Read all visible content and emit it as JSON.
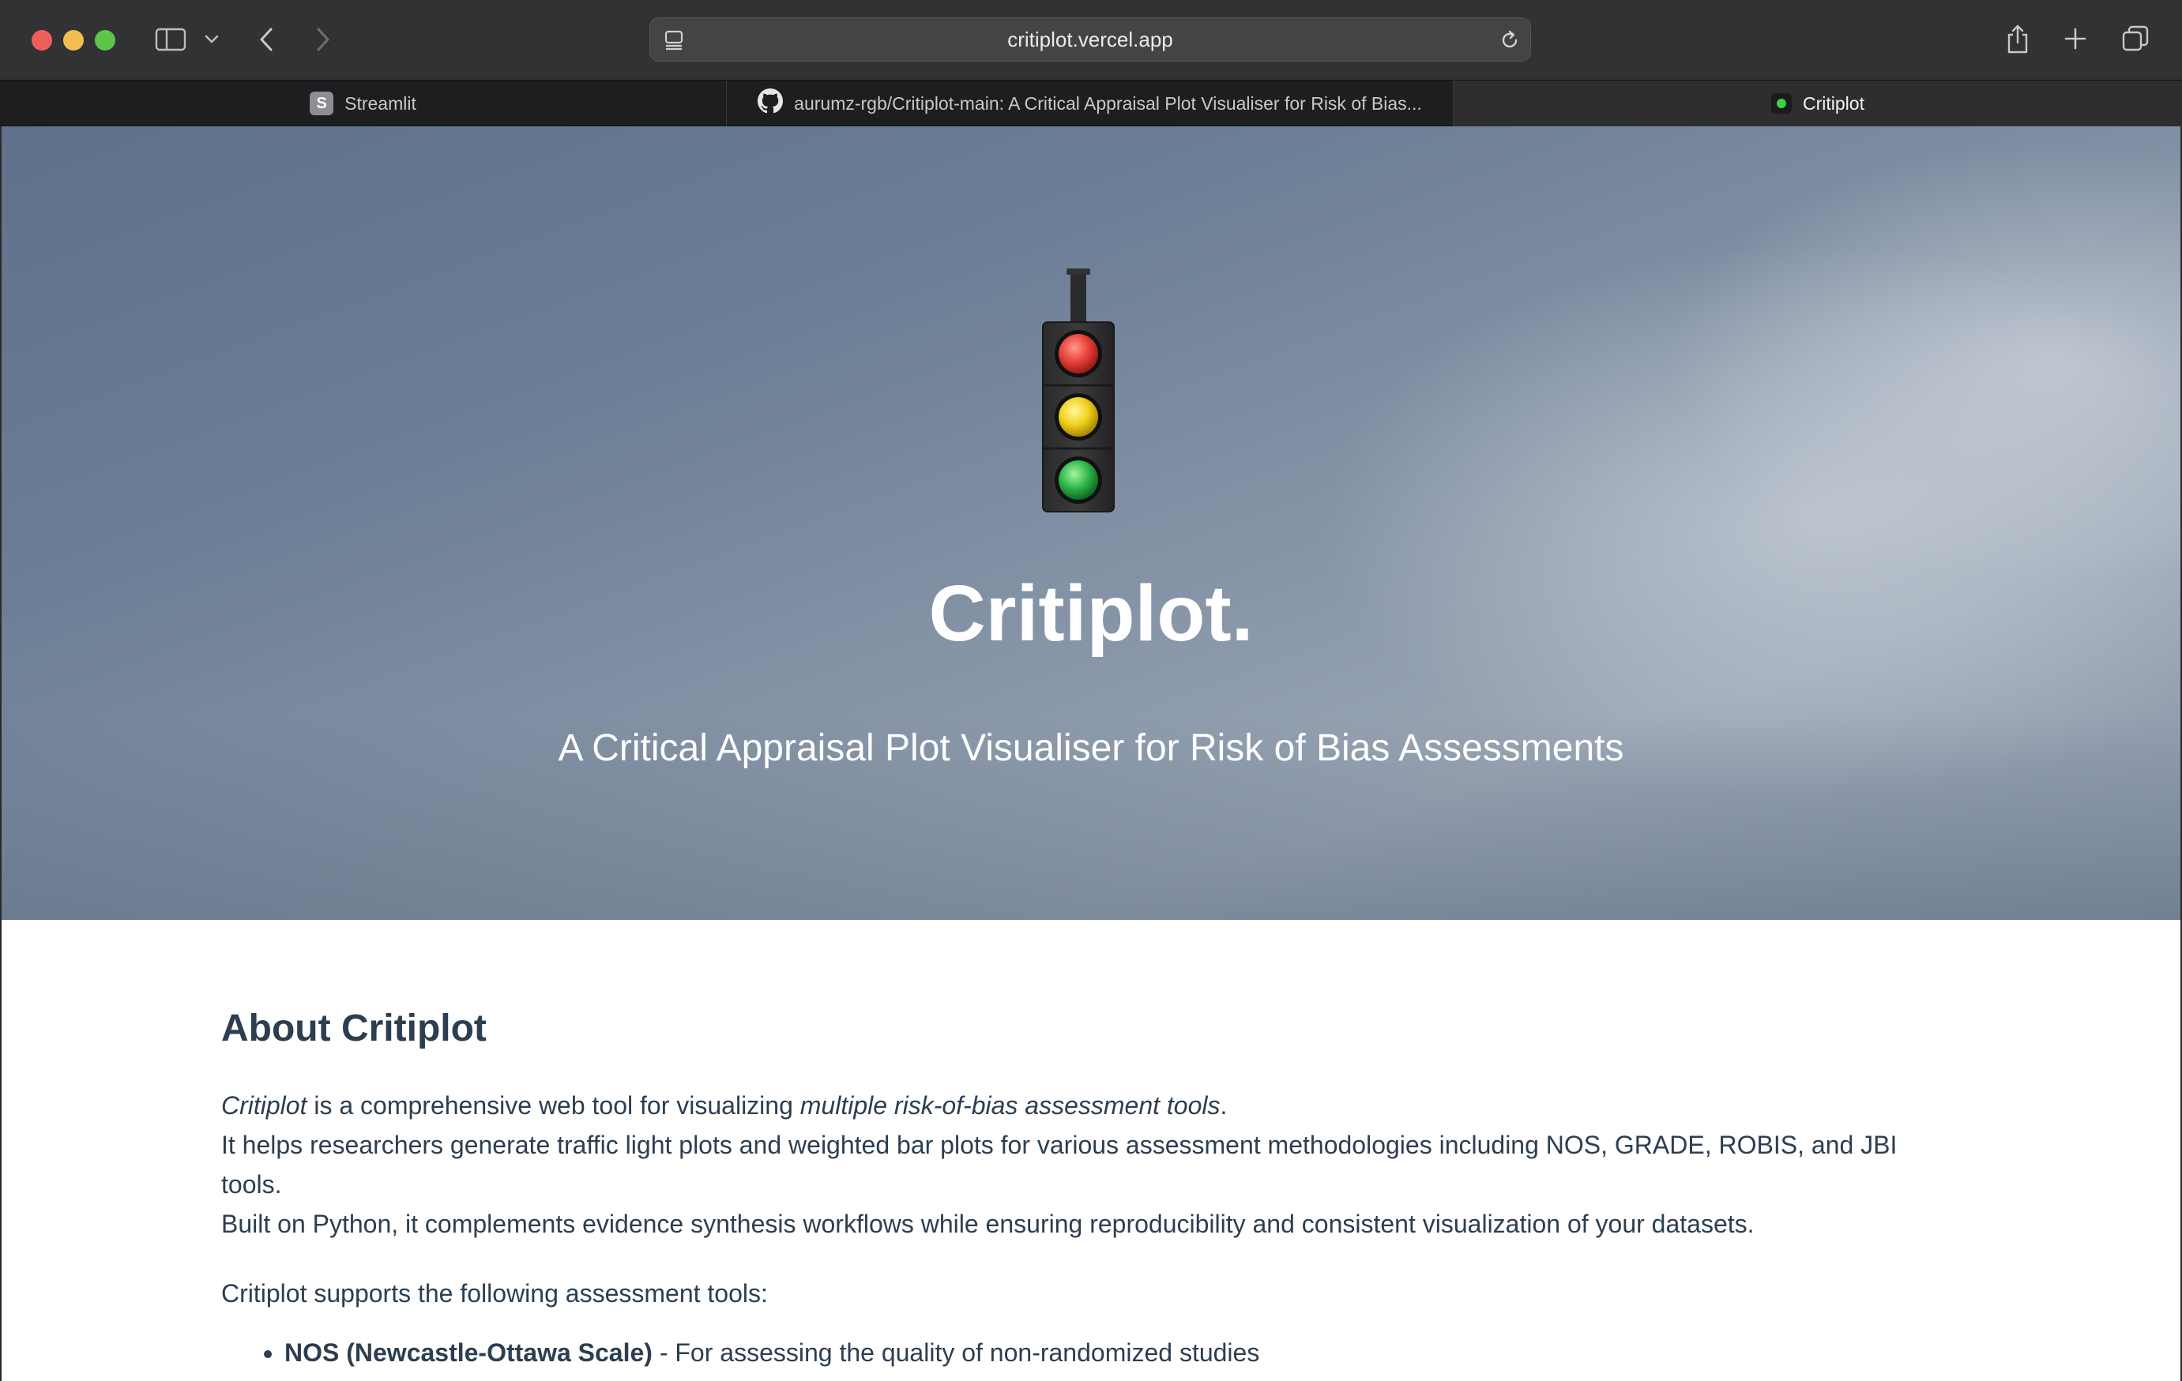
{
  "browser": {
    "url": "critiplot.vercel.app",
    "tabs": [
      {
        "label": "Streamlit",
        "favicon": "S"
      },
      {
        "label": "aurumz-rgb/Critiplot-main: A Critical Appraisal Plot Visualiser for Risk of Bias..."
      },
      {
        "label": "Critiplot",
        "active": true
      }
    ],
    "icons": [
      "sidebar-icon",
      "chevron-down-icon",
      "back-icon",
      "forward-icon",
      "page-menu-icon",
      "reload-icon",
      "share-icon",
      "plus-icon",
      "tabs-overview-icon"
    ]
  },
  "hero": {
    "title": "Critiplot.",
    "subtitle": "A Critical Appraisal Plot Visualiser for Risk of Bias Assessments",
    "icon": "traffic-light-icon"
  },
  "about": {
    "heading": "About Critiplot",
    "line1_em1": "Critiplot",
    "line1_mid": " is a comprehensive web tool for visualizing ",
    "line1_em2": "multiple risk-of-bias assessment tools",
    "line1_end": ".",
    "line2": "It helps researchers generate traffic light plots and weighted bar plots for various assessment methodologies including NOS, GRADE, ROBIS, and JBI tools.",
    "line3": "Built on Python, it complements evidence synthesis workflows while ensuring reproducibility and consistent visualization of your datasets.",
    "supports": "Critiplot supports the following assessment tools:",
    "tools": [
      {
        "name": "NOS (Newcastle-Ottawa Scale)",
        "desc": " - For assessing the quality of non-randomized studies"
      }
    ]
  },
  "colors": {
    "text": "#2c3e50",
    "chrome": "#323234",
    "tabbar": "#1e1e20",
    "light_red": "#e8413a",
    "light_yellow": "#f1d11c",
    "light_green": "#2fb84a"
  }
}
